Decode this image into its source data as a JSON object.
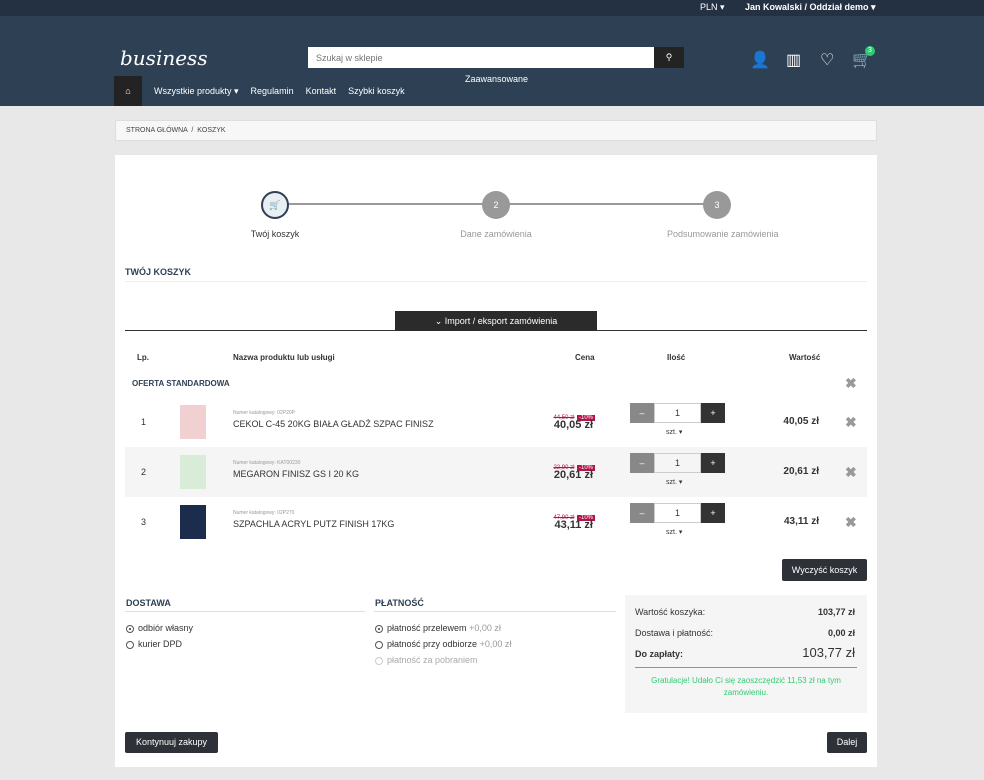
{
  "topbar": {
    "currency": "PLN ▾",
    "user": "Jan Kowalski / Oddział demo ▾"
  },
  "header": {
    "logo": "business",
    "search_placeholder": "Szukaj w sklepie",
    "advanced": "Zaawansowane",
    "cart_count": "3"
  },
  "nav": [
    "Wszystkie produkty ▾",
    "Regulamin",
    "Kontakt",
    "Szybki koszyk"
  ],
  "breadcrumb": [
    "STRONA GŁÓWNA",
    "KOSZYK"
  ],
  "steps": [
    {
      "num": "🛒",
      "label": "Twój koszyk"
    },
    {
      "num": "2",
      "label": "Dane zamówienia"
    },
    {
      "num": "3",
      "label": "Podsumowanie zamówienia"
    }
  ],
  "cart_title": "TWÓJ KOSZYK",
  "import_label": "⌄ Import / eksport zamówienia",
  "columns": {
    "lp": "Lp.",
    "name": "Nazwa produktu lub usługi",
    "price": "Cena",
    "qty": "Ilość",
    "value": "Wartość"
  },
  "group": "OFERTA STANDARDOWA",
  "items": [
    {
      "lp": "1",
      "catalog": "Numer katalogowy: 02P20P",
      "name": "CEKOL C-45 20KG BIAŁA GŁADŹ SZPAC FINISZ",
      "old": "44,50 zł",
      "disc": "-10%",
      "price": "40,05 zł",
      "qty": "1",
      "unit": "szt. ▾",
      "value": "40,05 zł"
    },
    {
      "lp": "2",
      "catalog": "Numer katalogowy: KAT00230",
      "name": "MEGARON FINISZ GS I 20 KG",
      "old": "22,90 zł",
      "disc": "-10%",
      "price": "20,61 zł",
      "qty": "1",
      "unit": "szt. ▾",
      "value": "20,61 zł"
    },
    {
      "lp": "3",
      "catalog": "Numer katalogowy: 02P270",
      "name": "SZPACHLA ACRYL PUTZ FINISH 17KG",
      "old": "47,90 zł",
      "disc": "-10%",
      "price": "43,11 zł",
      "qty": "1",
      "unit": "szt. ▾",
      "value": "43,11 zł"
    }
  ],
  "clear": "Wyczyść koszyk",
  "delivery": {
    "title": "DOSTAWA",
    "options": [
      "odbiór własny",
      "kurier DPD"
    ]
  },
  "payment": {
    "title": "PŁATNOŚĆ",
    "options": [
      {
        "label": "płatność przelewem",
        "extra": "+0,00 zł"
      },
      {
        "label": "płatność przy odbiorze",
        "extra": "+0,00 zł"
      },
      {
        "label": "płatność za pobraniem",
        "extra": ""
      }
    ]
  },
  "summary": {
    "cart_label": "Wartość koszyka:",
    "cart_value": "103,77 zł",
    "ship_label": "Dostawa i płatność:",
    "ship_value": "0,00 zł",
    "total_label": "Do zapłaty:",
    "total_value": "103,77 zł",
    "congrats": "Gratulacje! Udało Ci się zaoszczędzić 11,53 zł na tym zamówieniu."
  },
  "continue": "Kontynuuj zakupy",
  "next": "Dalej"
}
